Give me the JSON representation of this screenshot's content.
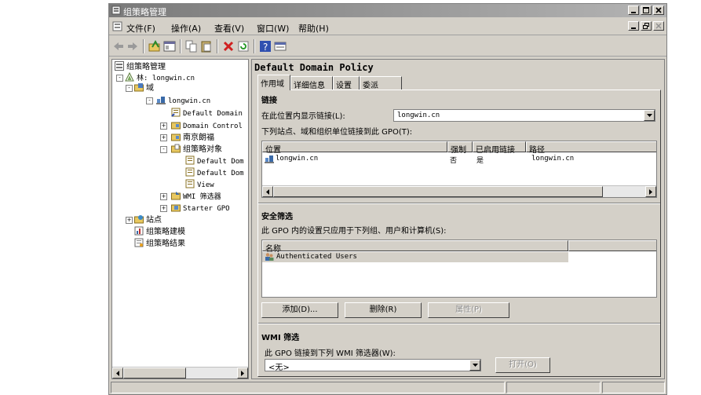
{
  "window": {
    "title": "组策略管理"
  },
  "menu": [
    {
      "label": "文件(F)"
    },
    {
      "label": "操作(A)"
    },
    {
      "label": "查看(V)"
    },
    {
      "label": "窗口(W)"
    },
    {
      "label": "帮助(H)"
    }
  ],
  "toolbar": {
    "icons": [
      "back-arrow-icon",
      "forward-arrow-icon",
      "up-folder-icon",
      "show-hide-tree-icon",
      "copy-icon",
      "paste-icon",
      "delete-icon",
      "refresh-icon",
      "help-icon",
      "properties-icon"
    ]
  },
  "tree": {
    "nodes": [
      {
        "label": "组策略管理"
      },
      {
        "label": "林: longwin.cn"
      },
      {
        "label": "域"
      },
      {
        "label": "longwin.cn"
      },
      {
        "label": "Default Domain"
      },
      {
        "label": "Domain Control"
      },
      {
        "label": "南京朗福"
      },
      {
        "label": "组策略对象"
      },
      {
        "label": "Default Dom"
      },
      {
        "label": "Default Dom"
      },
      {
        "label": "View"
      },
      {
        "label": "WMI 筛选器"
      },
      {
        "label": "Starter GPO"
      },
      {
        "label": "站点"
      },
      {
        "label": "组策略建模"
      },
      {
        "label": "组策略结果"
      }
    ]
  },
  "details": {
    "title": "Default Domain Policy",
    "tabs": [
      {
        "label": "作用域"
      },
      {
        "label": "详细信息"
      },
      {
        "label": "设置"
      },
      {
        "label": "委派"
      }
    ],
    "links": {
      "heading": "链接",
      "location_label": "在此位置内显示链接(L):",
      "location_value": "longwin.cn",
      "list_label": "下列站点、域和组织单位链接到此 GPO(T):",
      "columns": [
        "位置",
        "强制",
        "已启用链接",
        "路径"
      ],
      "rows": [
        {
          "location": "longwin.cn",
          "enforced": "否",
          "enabled": "是",
          "path": "longwin.cn"
        }
      ]
    },
    "security": {
      "heading": "安全筛选",
      "description": "此 GPO 内的设置只应用于下列组、用户和计算机(S):",
      "column": "名称",
      "rows": [
        {
          "name": "Authenticated Users"
        }
      ],
      "add_button": "添加(D)...",
      "remove_button": "删除(R)",
      "properties_button": "属性(P)"
    },
    "wmi": {
      "heading": "WMI 筛选",
      "description": "此 GPO 链接到下列 WMI 筛选器(W):",
      "value": "<无>",
      "open_button": "打开(O)"
    }
  }
}
